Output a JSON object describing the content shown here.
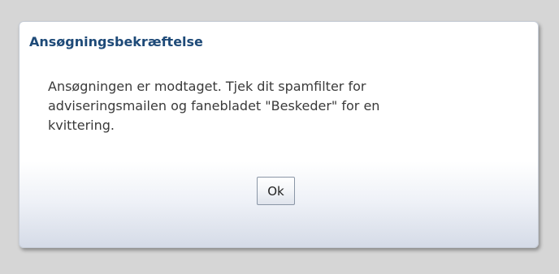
{
  "dialog": {
    "title": "Ansøgningsbekræftelse",
    "message": "Ansøgningen er modtaget. Tjek dit spamfilter for\nadviseringsmailen og fanebladet \"Beskeder\" for en\nkvittering.",
    "ok_label": "Ok"
  },
  "colors": {
    "background": "#d6d6d6",
    "title": "#1e4a78",
    "text": "#3a3a3a"
  }
}
